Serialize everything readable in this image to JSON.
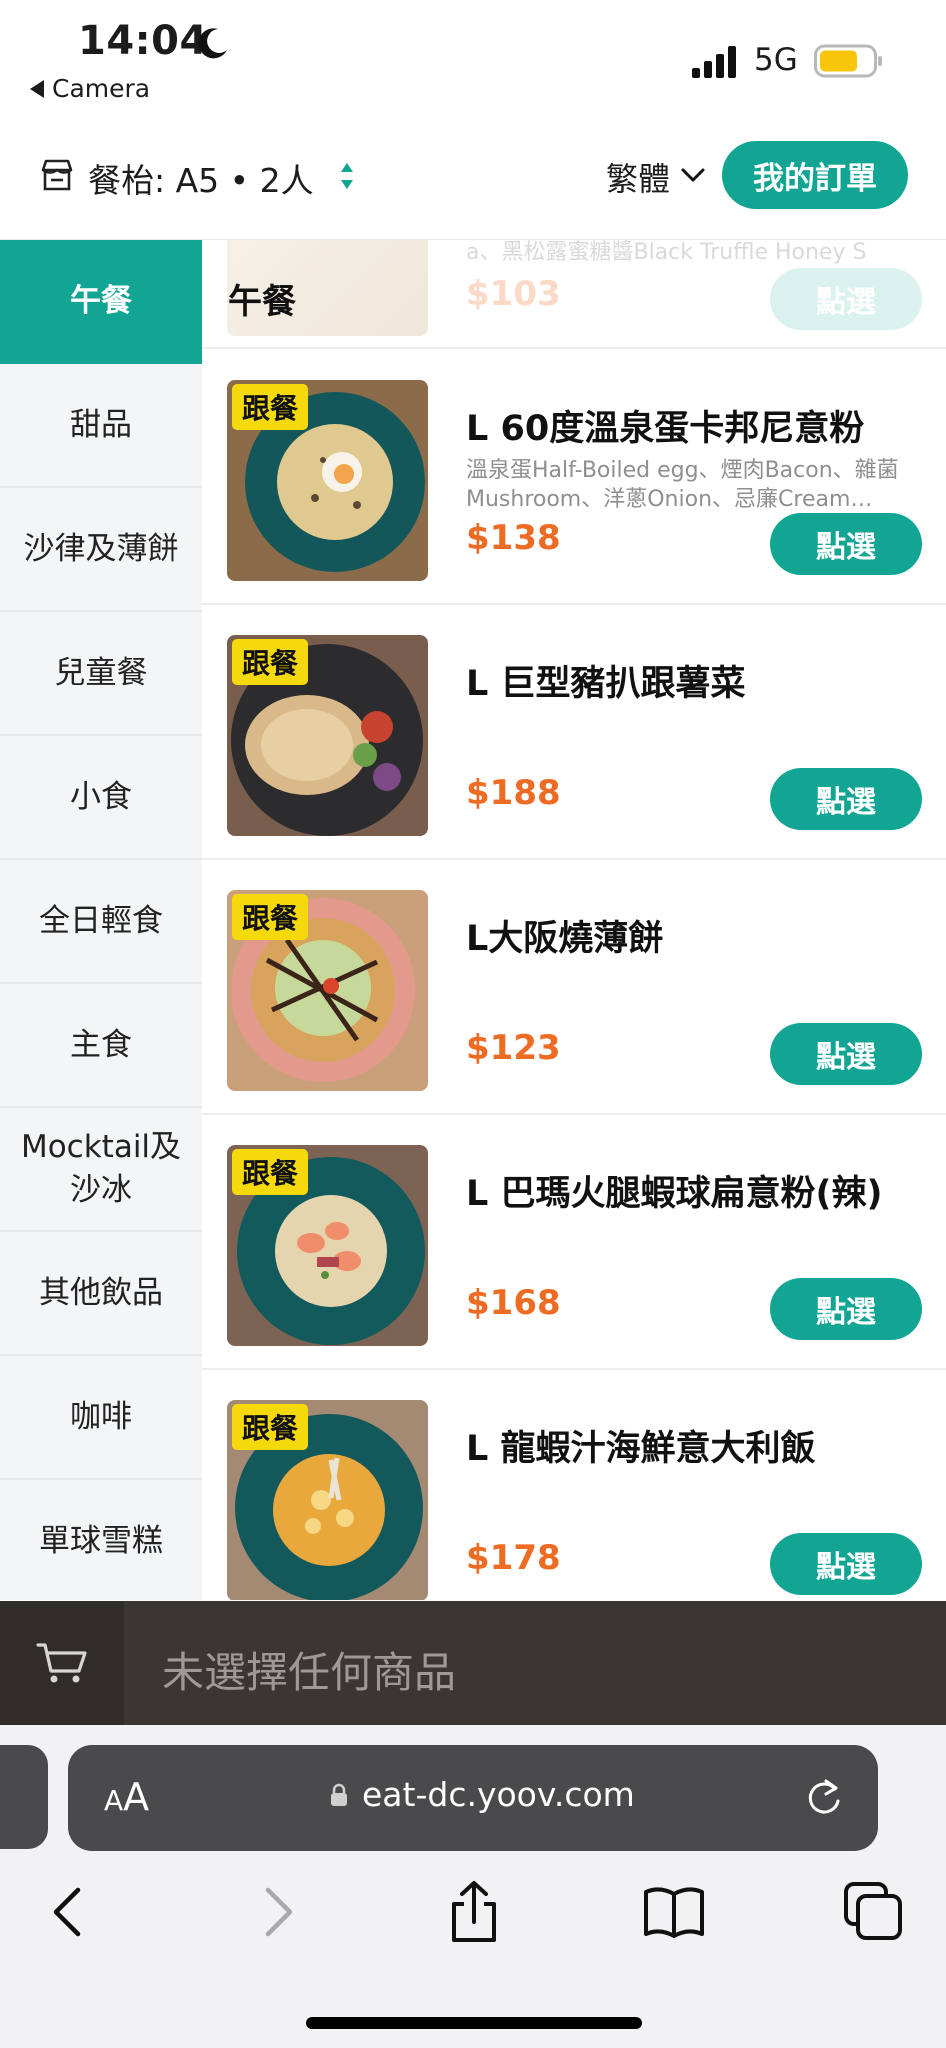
{
  "status_bar": {
    "time": "14:04",
    "back_label": "Camera",
    "network": "5G"
  },
  "header": {
    "table_info": "餐枱: A5 • 2人",
    "language": "繁體",
    "orders_button": "我的訂單"
  },
  "sidebar": {
    "categories": [
      {
        "label": "午餐",
        "active": true
      },
      {
        "label": "甜品"
      },
      {
        "label": "沙律及薄餅"
      },
      {
        "label": "兒童餐"
      },
      {
        "label": "小食"
      },
      {
        "label": "全日輕食"
      },
      {
        "label": "主食"
      },
      {
        "label": "Mocktail及沙冰"
      },
      {
        "label": "其他飲品"
      },
      {
        "label": "咖啡"
      },
      {
        "label": "單球雪糕"
      }
    ]
  },
  "section": {
    "title": "午餐",
    "partial_desc": "a、黑松露蜜糖醬Black Truffle Honey S",
    "partial_price": "$103",
    "partial_button": "點選"
  },
  "menu_items": [
    {
      "badge": "跟餐",
      "name": "L 60度溫泉蛋卡邦尼意粉",
      "desc": "溫泉蛋Half-Boiled egg、煙肉Bacon、雜菌Mushroom、洋蔥Onion、忌廉Cream…",
      "price": "$138",
      "button": "點選"
    },
    {
      "badge": "跟餐",
      "name": "L 巨型豬扒跟薯菜",
      "desc": "",
      "price": "$188",
      "button": "點選"
    },
    {
      "badge": "跟餐",
      "name": "L大阪燒薄餅",
      "desc": "",
      "price": "$123",
      "button": "點選"
    },
    {
      "badge": "跟餐",
      "name": "L 巴瑪火腿蝦球扁意粉(辣)",
      "desc": "",
      "price": "$168",
      "button": "點選"
    },
    {
      "badge": "跟餐",
      "name": "L 龍蝦汁海鮮意大利飯",
      "desc": "",
      "price": "$178",
      "button": "點選"
    }
  ],
  "cart": {
    "empty_text": "未選擇任何商品"
  },
  "browser": {
    "url": "eat-dc.yoov.com",
    "aa_big": "A",
    "aa_small": "A"
  },
  "colors": {
    "accent": "#12a594",
    "price": "#ee6b24",
    "badge": "#f5d90a",
    "cart_bar": "#3a3634"
  }
}
